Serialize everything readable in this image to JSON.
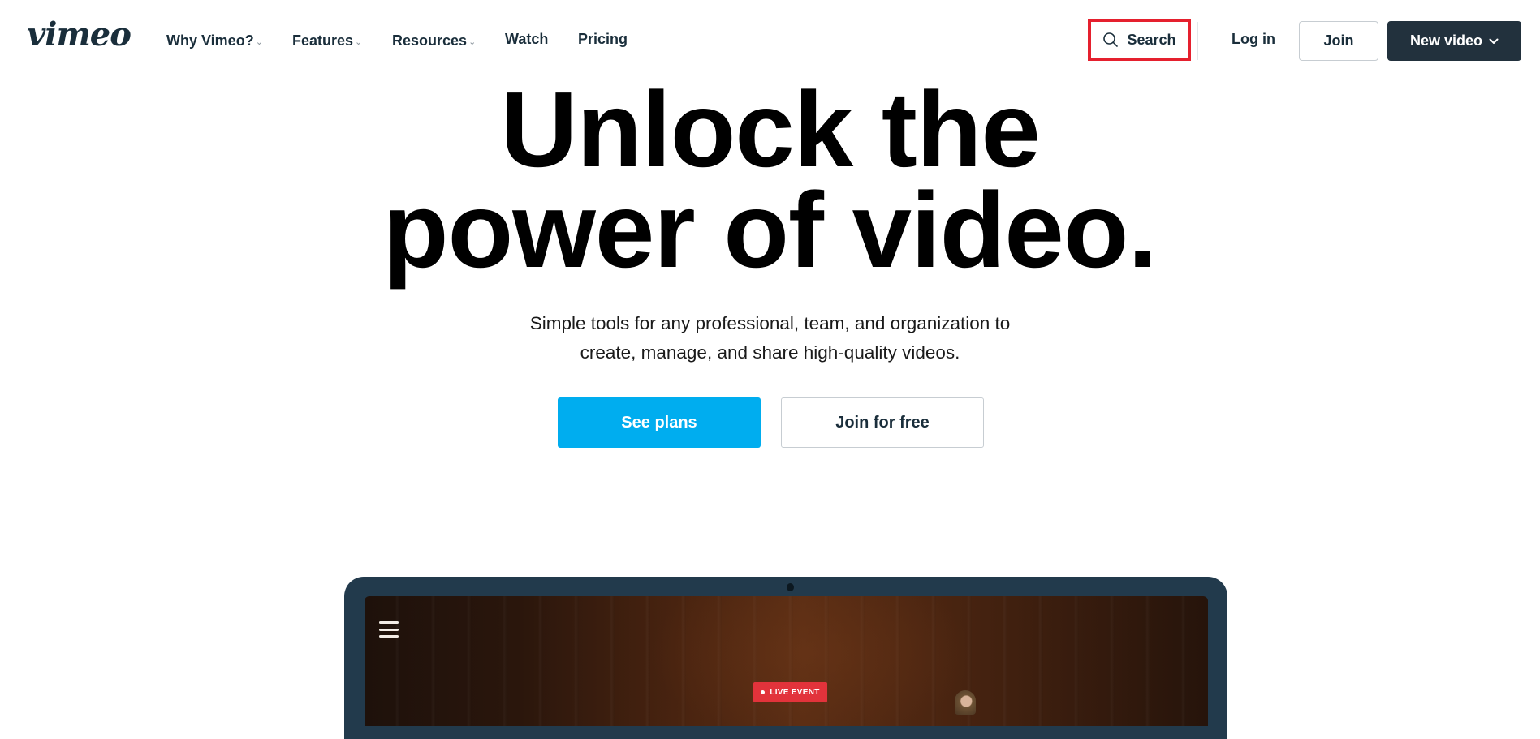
{
  "header": {
    "logo": "vimeo",
    "nav": [
      {
        "label": "Why Vimeo?",
        "has_dropdown": true
      },
      {
        "label": "Features",
        "has_dropdown": true
      },
      {
        "label": "Resources",
        "has_dropdown": true
      },
      {
        "label": "Watch",
        "has_dropdown": false
      },
      {
        "label": "Pricing",
        "has_dropdown": false
      }
    ],
    "search_label": "Search",
    "login_label": "Log in",
    "join_label": "Join",
    "new_video_label": "New video",
    "icons": {
      "search": "search-icon",
      "dropdown": "chevron-down-icon"
    }
  },
  "hero": {
    "headline_line1": "Unlock the",
    "headline_line2": "power of video.",
    "subtitle_line1": "Simple tools for any professional, team, and organization to",
    "subtitle_line2": "create, manage, and share high-quality videos.",
    "primary_cta": "See plans",
    "secondary_cta": "Join for free"
  },
  "preview": {
    "menu_icon": "hamburger-icon",
    "badge": "LIVE EVENT"
  },
  "colors": {
    "brand_dark": "#1a2e3b",
    "primary_cta": "#00adef",
    "new_video_bg": "#22313d",
    "highlight_border": "#e5202e",
    "live_badge": "#e2333b",
    "laptop_frame": "#223a4c"
  }
}
